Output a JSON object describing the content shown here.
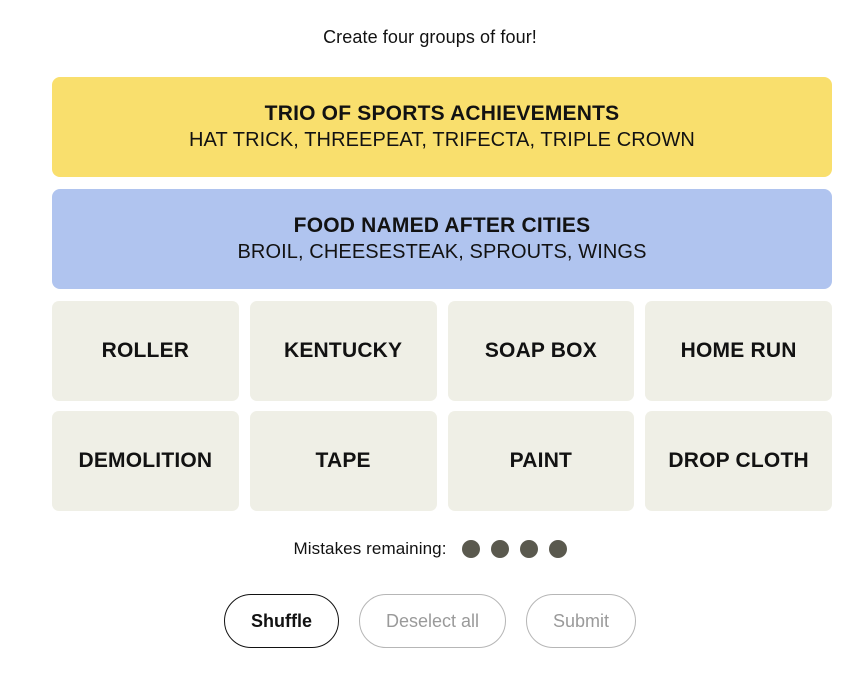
{
  "header": {
    "instruction": "Create four groups of four!"
  },
  "solved_groups": [
    {
      "title": "TRIO OF SPORTS ACHIEVEMENTS",
      "words": "HAT TRICK, THREEPEAT, TRIFECTA, TRIPLE CROWN",
      "color": "#f9df6d",
      "difficulty": "yellow"
    },
    {
      "title": "FOOD NAMED AFTER CITIES",
      "words": "BROIL, CHEESESTEAK, SPROUTS, WINGS",
      "color": "#b0c4ef",
      "difficulty": "blue"
    }
  ],
  "grid": {
    "tile_color": "#efefe6",
    "tiles": [
      "ROLLER",
      "KENTUCKY",
      "SOAP BOX",
      "HOME RUN",
      "DEMOLITION",
      "TAPE",
      "PAINT",
      "DROP CLOTH"
    ]
  },
  "mistakes": {
    "label": "Mistakes remaining:",
    "remaining": 4,
    "dot_color": "#5a594e"
  },
  "actions": {
    "shuffle_label": "Shuffle",
    "deselect_label": "Deselect all",
    "submit_label": "Submit",
    "shuffle_enabled": true,
    "deselect_enabled": false,
    "submit_enabled": false
  }
}
